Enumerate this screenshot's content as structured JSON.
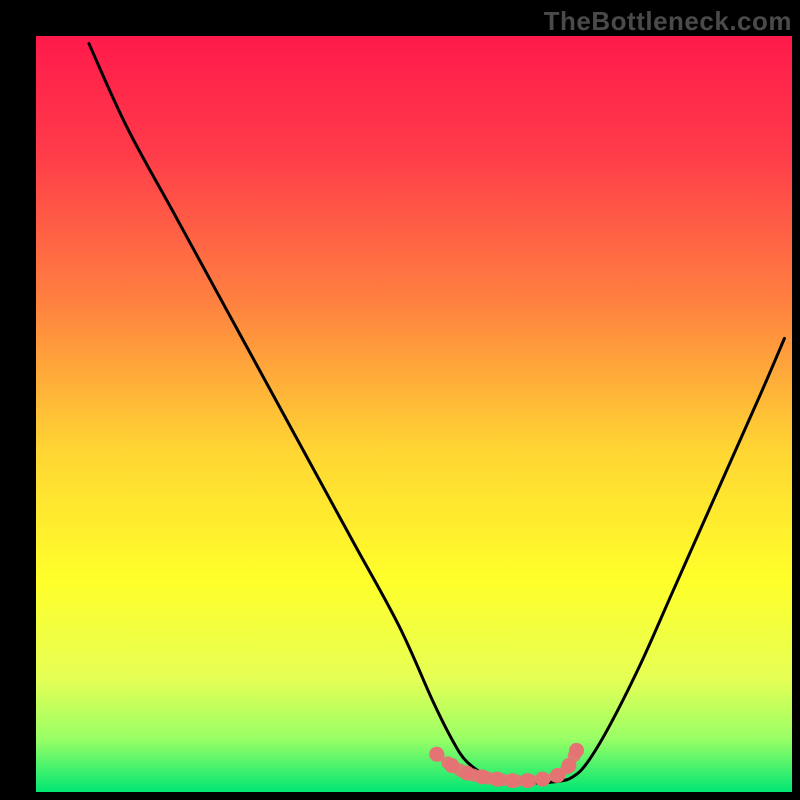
{
  "watermark": "TheBottleneck.com",
  "chart_data": {
    "type": "line",
    "title": "",
    "xlabel": "",
    "ylabel": "",
    "xlim": [
      0,
      100
    ],
    "ylim": [
      0,
      100
    ],
    "gradient_stops": [
      {
        "offset": 0,
        "color": "#ff1a4b"
      },
      {
        "offset": 0.15,
        "color": "#ff3a4a"
      },
      {
        "offset": 0.35,
        "color": "#ff8040"
      },
      {
        "offset": 0.55,
        "color": "#ffd633"
      },
      {
        "offset": 0.72,
        "color": "#ffff2a"
      },
      {
        "offset": 0.85,
        "color": "#e6ff55"
      },
      {
        "offset": 0.93,
        "color": "#99ff66"
      },
      {
        "offset": 1,
        "color": "#00e673"
      }
    ],
    "series": [
      {
        "name": "curve",
        "color": "#000000",
        "x": [
          7.0,
          12,
          18,
          24,
          30,
          36,
          42,
          48,
          52.5,
          55,
          57,
          60,
          63,
          66,
          69,
          71,
          73,
          76,
          80,
          84,
          88,
          92,
          96,
          99
        ],
        "y": [
          99,
          88,
          77,
          66,
          55,
          44,
          33,
          22,
          12,
          7,
          4,
          2,
          1.5,
          1.2,
          1.4,
          2,
          4,
          9,
          17,
          26,
          35,
          44,
          53,
          60
        ]
      },
      {
        "name": "bottom-dots",
        "color": "#e57373",
        "style": "dotted-thick",
        "x": [
          53,
          55,
          57,
          59,
          61,
          63,
          65,
          67,
          69,
          70.5,
          71.5
        ],
        "y": [
          5,
          3.5,
          2.5,
          2,
          1.7,
          1.5,
          1.5,
          1.7,
          2.2,
          3.5,
          5.5
        ]
      }
    ]
  }
}
